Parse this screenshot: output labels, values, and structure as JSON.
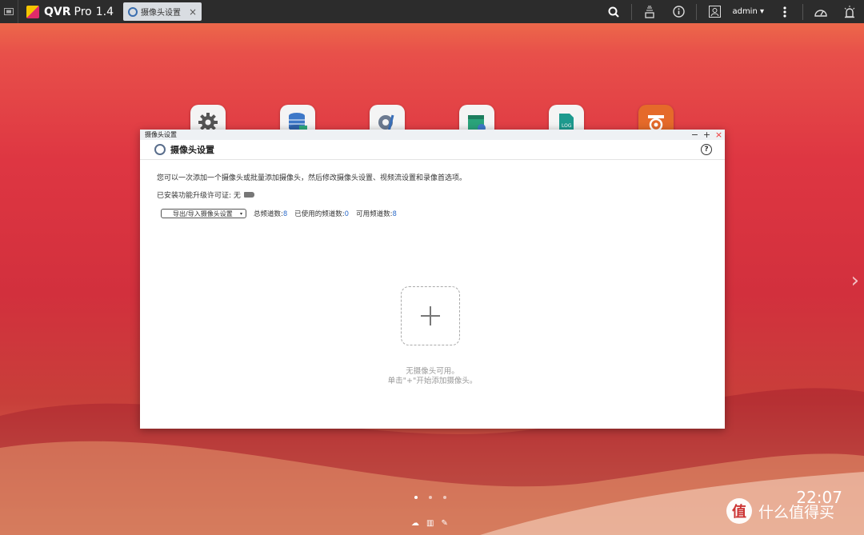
{
  "app": {
    "name": "QVR",
    "product": "Pro",
    "version": "1.4"
  },
  "tab": {
    "label": "摄像头设置",
    "close": "×"
  },
  "topbar": {
    "user": "admin ▾"
  },
  "window": {
    "titlebar": "摄像头设置",
    "heading": "摄像头设置",
    "description": "您可以一次添加一个摄像头或批量添加摄像头，然后修改摄像头设置、视频流设置和录像首选项。",
    "license": "已安装功能升级许可证: 无",
    "select": {
      "value": "导出/导入摄像头设置",
      "arrow": "▾"
    },
    "stats": [
      {
        "label": "总频道数:",
        "value": "8"
      },
      {
        "label": "已使用的频道数:",
        "value": "0"
      },
      {
        "label": "可用频道数:",
        "value": "8"
      }
    ],
    "empty_line1": "无摄像头可用。",
    "empty_line2": "单击\"+\"开始添加摄像头。",
    "help": "?"
  },
  "desktop": {
    "clock": "22:07"
  },
  "watermark": {
    "circle": "值",
    "text": "什么值得买"
  },
  "colors": {
    "accent": "#2e6cc9",
    "topbar": "#2c2c2c",
    "close": "#e33333"
  }
}
